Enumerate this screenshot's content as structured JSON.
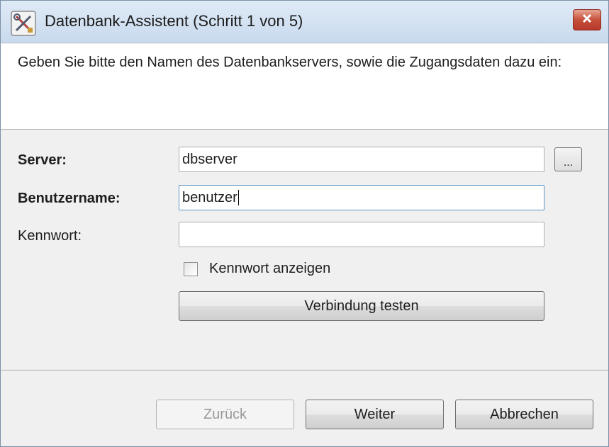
{
  "window": {
    "title": "Datenbank-Assistent (Schritt 1 von 5)",
    "close_label": "×"
  },
  "header": {
    "instruction": "Geben Sie bitte den Namen des Datenbankservers, sowie die Zugangsdaten dazu ein:"
  },
  "form": {
    "server_label": "Server:",
    "server_value": "dbserver",
    "browse_label": "...",
    "username_label": "Benutzername:",
    "username_value": "benutzer",
    "password_label": "Kennwort:",
    "password_value": "",
    "show_password_label": "Kennwort anzeigen",
    "show_password_checked": false,
    "test_connection_label": "Verbindung testen"
  },
  "footer": {
    "back_label": "Zurück",
    "next_label": "Weiter",
    "cancel_label": "Abbrechen"
  },
  "colors": {
    "close_button": "#c6503a",
    "title_bar": "#c9daee",
    "focus_border": "#5c93bf"
  },
  "icons": {
    "app": "tools-icon",
    "close": "close-icon"
  }
}
